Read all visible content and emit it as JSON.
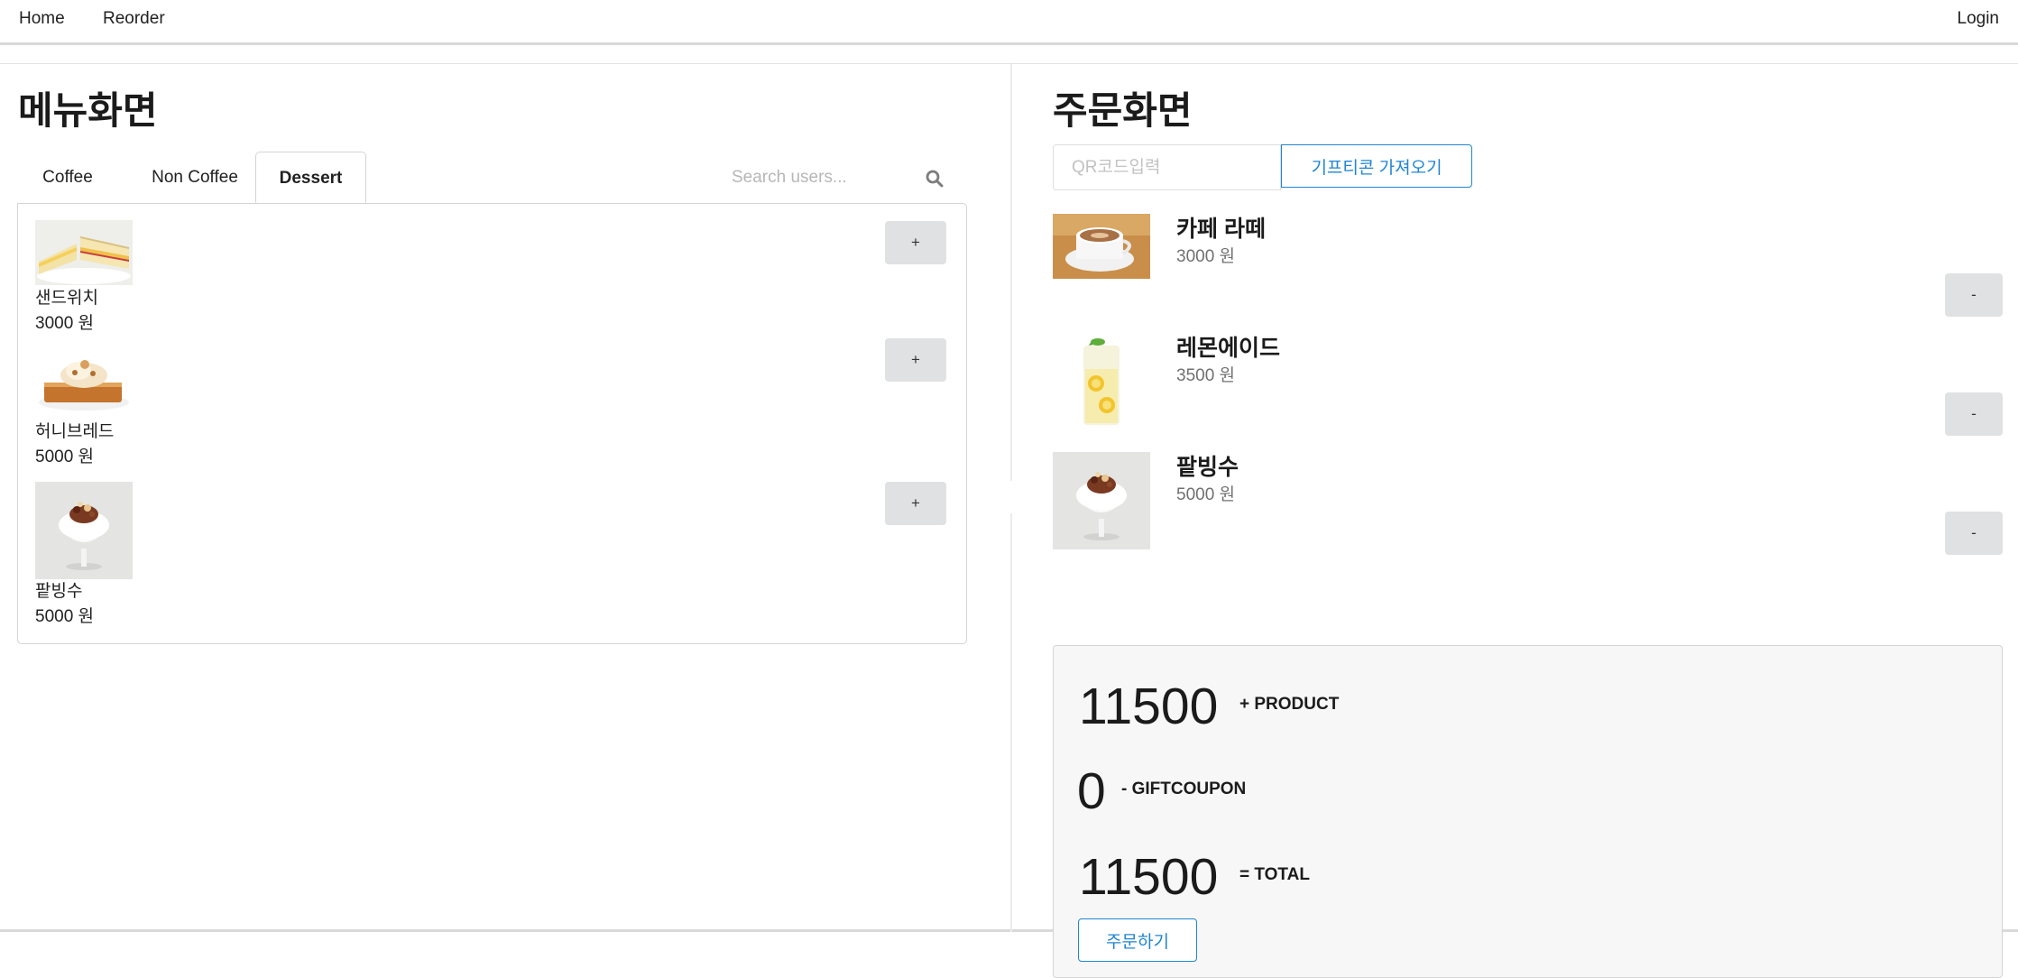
{
  "nav": {
    "home": "Home",
    "reorder": "Reorder",
    "login": "Login"
  },
  "menu": {
    "title": "메뉴화면",
    "tabs": [
      {
        "label": "Coffee",
        "active": false
      },
      {
        "label": "Non Coffee",
        "active": false
      },
      {
        "label": "Dessert",
        "active": true
      }
    ],
    "search": {
      "placeholder": "Search users...",
      "icon": "search-icon"
    },
    "items": [
      {
        "name": "샌드위치",
        "price": "3000 원",
        "button": "+"
      },
      {
        "name": "허니브레드",
        "price": "5000 원",
        "button": "+"
      },
      {
        "name": "팥빙수",
        "price": "5000 원",
        "button": "+"
      }
    ]
  },
  "order": {
    "title": "주문화면",
    "qr": {
      "placeholder": "QR코드입력",
      "value": ""
    },
    "gift_button": "기프티콘 가져오기",
    "items": [
      {
        "name": "카페 라떼",
        "price": "3000 원",
        "button": "-"
      },
      {
        "name": "레몬에이드",
        "price": "3500 원",
        "button": "-"
      },
      {
        "name": "팥빙수",
        "price": "5000 원",
        "button": "-"
      }
    ],
    "totals": {
      "product_value": "11500",
      "product_label": "+ PRODUCT",
      "coupon_value": "0",
      "coupon_label": "- GIFTCOUPON",
      "total_value": "11500",
      "total_label": "= TOTAL"
    },
    "order_button": "주문하기"
  },
  "colors": {
    "accent": "#2185d0",
    "button_grey": "#e0e1e2",
    "panel_bg": "#f7f7f7"
  }
}
